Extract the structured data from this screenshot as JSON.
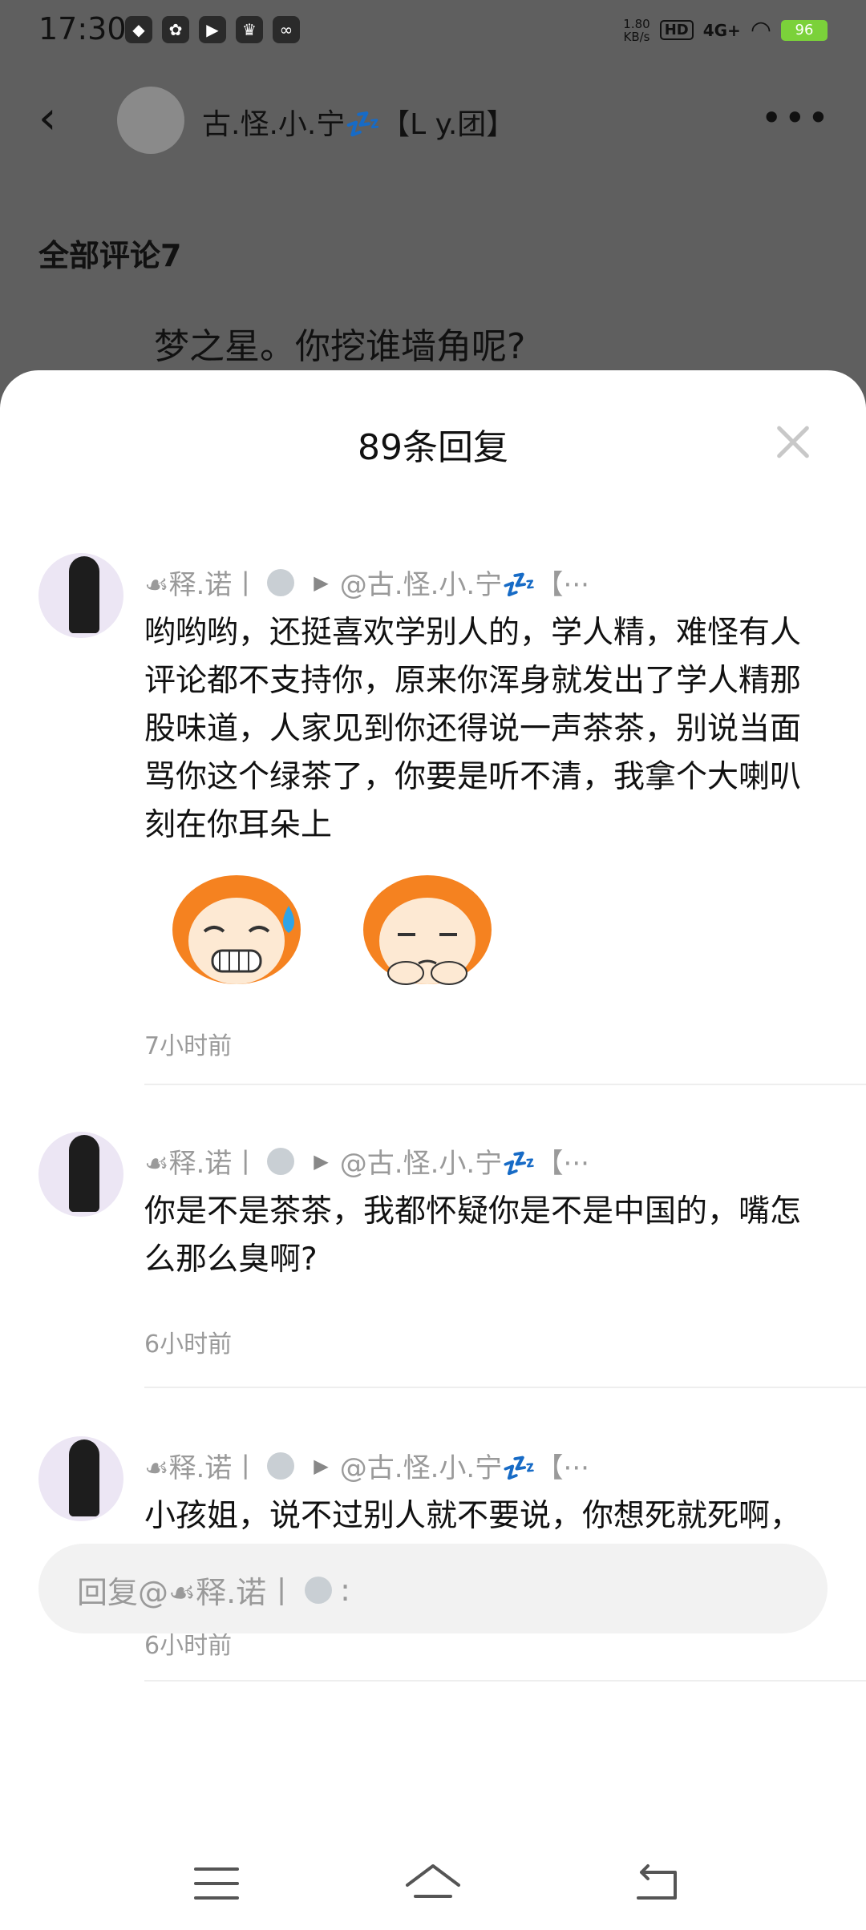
{
  "status_bar": {
    "time": "17:30",
    "speed_value": "1.80",
    "speed_unit": "KB/s",
    "hd": "HD",
    "network": "4G+",
    "battery": "96",
    "app_icons": [
      "app-1-icon",
      "app-2-icon",
      "play-icon",
      "crown-icon",
      "link-icon"
    ]
  },
  "topbar": {
    "title": "古.怪.小.宁💤【L y.团】"
  },
  "background": {
    "all_comments": "全部评论7",
    "comment_text": "梦之星。你挖谁墙角呢?"
  },
  "sheet": {
    "title": "89条回复",
    "replies": [
      {
        "author": "☙释.诺丨",
        "target": "@古.怪.小.宁💤【···",
        "text": "哟哟哟，还挺喜欢学别人的，学人精，难怪有人评论都不支持你，原来你浑身就发出了学人精那股味道，人家见到你还得说一声茶茶，别说当面骂你这个绿茶了，你要是听不清，我拿个大喇叭刻在你耳朵上",
        "time": "7小时前"
      },
      {
        "author": "☙释.诺丨",
        "target": "@古.怪.小.宁💤【···",
        "text": "你是不是茶茶，我都怀疑你是不是中国的，嘴怎么那么臭啊?",
        "time": "6小时前"
      },
      {
        "author": "☙释.诺丨",
        "target": "@古.怪.小.宁💤【···",
        "text": "小孩姐，说不过别人就不要说，你想死就死啊，正好让我乐一下",
        "time": "6小时前"
      }
    ]
  },
  "input": {
    "placeholder_prefix": "回复@☙释.诺丨",
    "placeholder_suffix": ":"
  },
  "colors": {
    "overlay": "#5f5f5f",
    "sheet_bg": "#ffffff",
    "meta_gray": "#9a9a9a",
    "sticker_orange": "#f58220"
  }
}
